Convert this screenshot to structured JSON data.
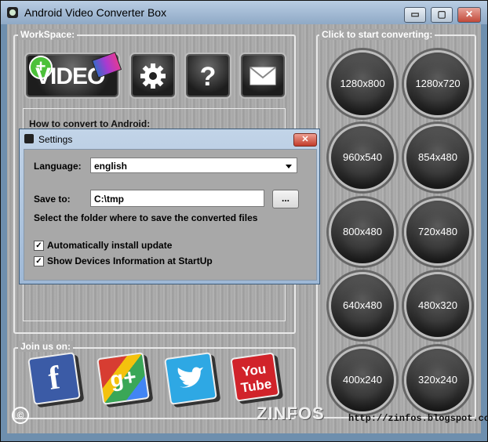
{
  "window": {
    "title": "Android Video Converter Box",
    "minimize": "▭",
    "maximize": "▢",
    "close": "✕"
  },
  "workspace": {
    "label": "WorkSpace:",
    "video_button": "VIDEO",
    "how_to": "How to convert to Android:"
  },
  "convert": {
    "label": "Click to start converting:",
    "resolutions": [
      "1280x800",
      "1280x720",
      "960x540",
      "854x480",
      "800x480",
      "720x480",
      "640x480",
      "480x320",
      "400x240",
      "320x240"
    ]
  },
  "join": {
    "label": "Join us on:",
    "networks": [
      "f",
      "g+",
      "twitter",
      "You Tube"
    ]
  },
  "watermark": {
    "brand": "ZINFOS",
    "url": "http://zinfos.blogspot.com",
    "copyright": "©"
  },
  "settings": {
    "title": "Settings",
    "language_label": "Language:",
    "language_value": "english",
    "save_to_label": "Save to:",
    "save_to_value": "C:\\tmp",
    "browse_label": "...",
    "hint": "Select the folder where to save the converted files",
    "auto_update": "Automatically install update",
    "show_devices": "Show Devices Information at StartUp"
  }
}
